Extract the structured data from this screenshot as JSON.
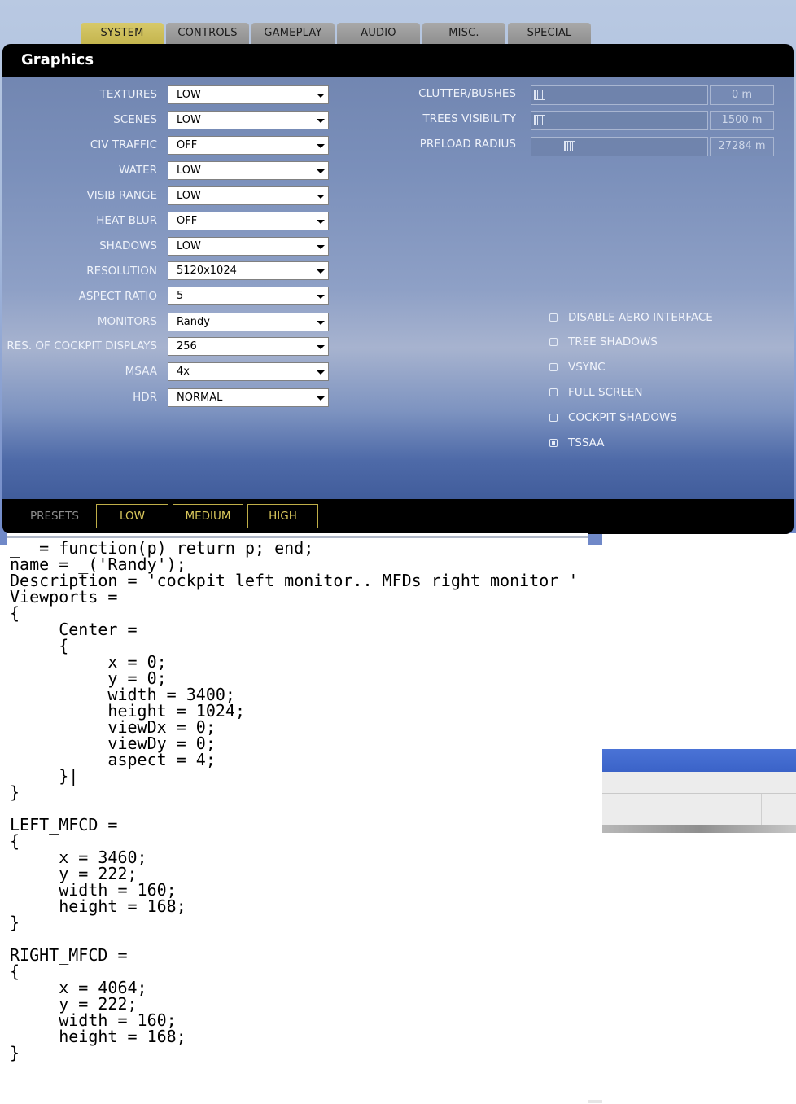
{
  "tabs": [
    {
      "label": "SYSTEM",
      "active": true
    },
    {
      "label": "CONTROLS",
      "active": false
    },
    {
      "label": "GAMEPLAY",
      "active": false
    },
    {
      "label": "AUDIO",
      "active": false
    },
    {
      "label": "MISC.",
      "active": false
    },
    {
      "label": "SPECIAL",
      "active": false
    }
  ],
  "panel": {
    "title": "Graphics",
    "settings": [
      {
        "label": "TEXTURES",
        "value": "LOW"
      },
      {
        "label": "SCENES",
        "value": "LOW"
      },
      {
        "label": "CIV TRAFFIC",
        "value": "OFF"
      },
      {
        "label": "WATER",
        "value": "LOW"
      },
      {
        "label": "VISIB RANGE",
        "value": "LOW"
      },
      {
        "label": "HEAT BLUR",
        "value": "OFF"
      },
      {
        "label": "SHADOWS",
        "value": "LOW"
      },
      {
        "label": "RESOLUTION",
        "value": "5120x1024"
      },
      {
        "label": "ASPECT RATIO",
        "value": "5"
      },
      {
        "label": "MONITORS",
        "value": "Randy"
      },
      {
        "label": "RES. OF COCKPIT DISPLAYS",
        "value": "256"
      },
      {
        "label": "MSAA",
        "value": "4x"
      },
      {
        "label": "HDR",
        "value": "NORMAL"
      }
    ],
    "sliders": [
      {
        "label": "CLUTTER/BUSHES",
        "value": "0 m",
        "level": 0.0
      },
      {
        "label": "TREES VISIBILITY",
        "value": "1500 m",
        "level": 0.0
      },
      {
        "label": "PRELOAD RADIUS",
        "value": "27284 m",
        "level": 0.19
      }
    ],
    "checkboxes": [
      {
        "label": "DISABLE AERO INTERFACE",
        "checked": false
      },
      {
        "label": "TREE SHADOWS",
        "checked": false
      },
      {
        "label": "VSYNC",
        "checked": false
      },
      {
        "label": "FULL SCREEN",
        "checked": false
      },
      {
        "label": "COCKPIT SHADOWS",
        "checked": false
      },
      {
        "label": "TSSAA",
        "checked": true
      }
    ],
    "presets": {
      "label": "PRESETS",
      "buttons": [
        "LOW",
        "MEDIUM",
        "HIGH"
      ]
    }
  },
  "editor": {
    "code": "_  = function(p) return p; end;\nname = _('Randy');\nDescription = 'cockpit left monitor.. MFDs right monitor '\nViewports =\n{\n     Center =\n     {\n          x = 0;\n          y = 0;\n          width = 3400;\n          height = 1024;\n          viewDx = 0;\n          viewDy = 0;\n          aspect = 4;\n     }|\n}\n\nLEFT_MFCD =\n{\n     x = 3460;\n     y = 222;\n     width = 160;\n     height = 168;\n}\n\nRIGHT_MFCD =\n{\n     x = 4064;\n     y = 222;\n     width = 160;\n     height = 168;\n}"
  }
}
